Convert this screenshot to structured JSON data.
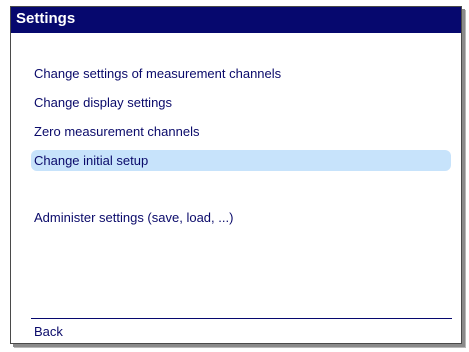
{
  "window": {
    "title": "Settings"
  },
  "menu": {
    "items": [
      {
        "label": "Change settings of measurement channels",
        "selected": false
      },
      {
        "label": "Change display settings",
        "selected": false
      },
      {
        "label": "Zero measurement channels",
        "selected": false
      },
      {
        "label": "Change initial setup",
        "selected": true
      },
      {
        "label": "Administer settings (save, load, ...)",
        "selected": false
      }
    ]
  },
  "footer": {
    "back_label": "Back"
  },
  "colors": {
    "titlebar": "#06086e",
    "text": "#0a0a6a",
    "selection": "#c7e3fb"
  }
}
